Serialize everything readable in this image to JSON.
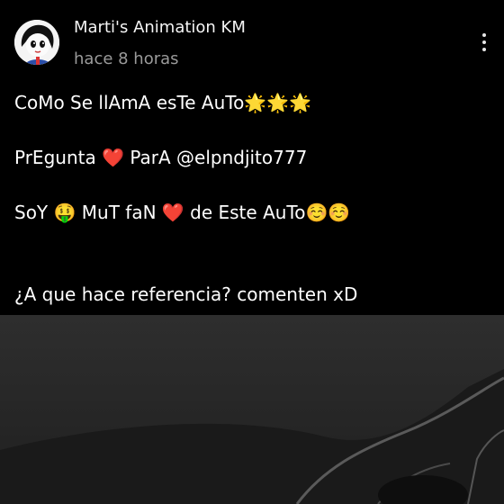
{
  "post": {
    "author": "Marti's Animation KM",
    "time": "hace 8 horas",
    "lines": [
      "CoMo Se llAmA esTe AuTo🌟🌟🌟",
      "PrEgunta ❤️ ParA @elpndjito777",
      "SoY 🤑 MuT faN ❤️ de Este AuTo☺️☺️",
      "¿A que hace referencia? comenten xD"
    ],
    "menu_icon": "more-vertical-icon",
    "avatar_icon": "cartoon-avatar"
  }
}
